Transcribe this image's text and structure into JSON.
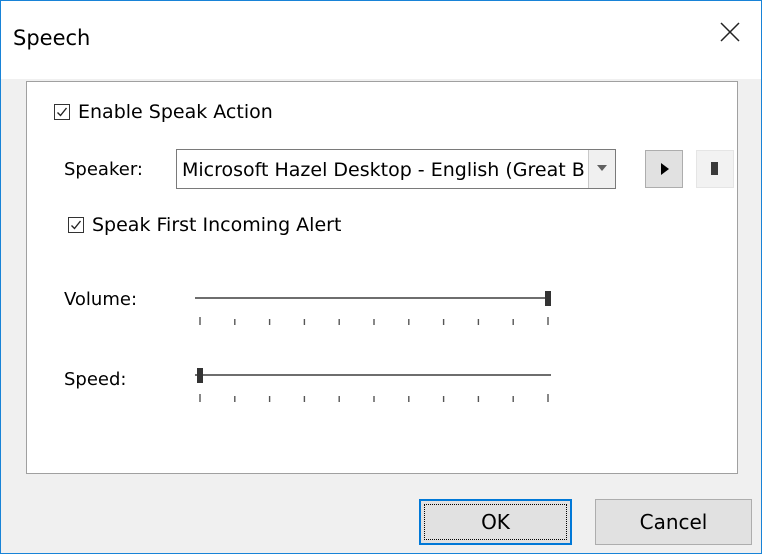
{
  "window": {
    "title": "Speech"
  },
  "enable_speak_action": {
    "label": "Enable Speak Action",
    "checked": true
  },
  "speaker": {
    "label": "Speaker:",
    "selected": "Microsoft Hazel Desktop - English (Great Britain)"
  },
  "speak_first_alert": {
    "label": "Speak First Incoming Alert",
    "checked": true
  },
  "volume": {
    "label": "Volume:",
    "level_fraction": 1.0,
    "tick_count": 11
  },
  "speed": {
    "label": "Speed:",
    "level_fraction": 0.0,
    "tick_count": 11
  },
  "buttons": {
    "ok": "OK",
    "cancel": "Cancel"
  },
  "colors": {
    "accent": "#0078d7",
    "window_border": "#1883d7",
    "dialog_bg": "#f0f0f0"
  },
  "icons": {
    "play": "play-icon",
    "stop": "stop-icon",
    "close": "close-icon",
    "dropdown": "chevron-down-icon",
    "check": "checkmark-icon"
  }
}
